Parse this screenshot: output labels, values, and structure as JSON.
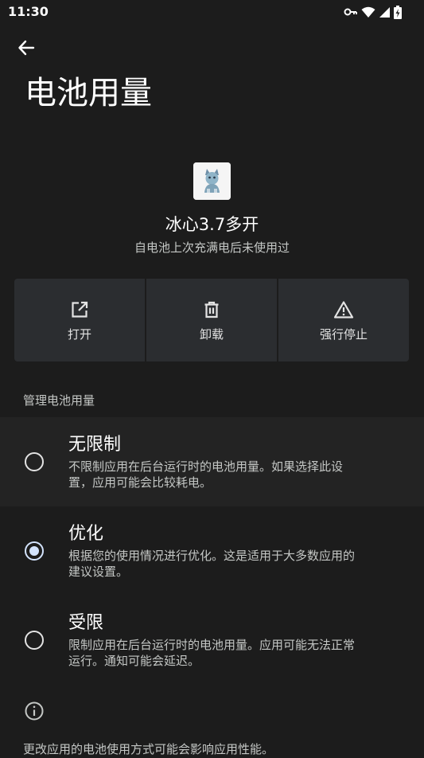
{
  "status_bar": {
    "time": "11:30",
    "icons": [
      "vpn-key-icon",
      "wifi-icon",
      "signal-icon",
      "battery-charging-icon"
    ]
  },
  "header": {
    "back_icon": "arrow-back-icon",
    "title": "电池用量"
  },
  "app": {
    "icon": "app-avatar-icon",
    "name": "冰心3.7多开",
    "summary": "自电池上次充满电后未使用过"
  },
  "actions": [
    {
      "icon": "open-external-icon",
      "label": "打开"
    },
    {
      "icon": "trash-icon",
      "label": "卸载"
    },
    {
      "icon": "warning-icon",
      "label": "强行停止"
    }
  ],
  "manage_section": {
    "header": "管理电池用量",
    "options": [
      {
        "title": "无限制",
        "description": "不限制应用在后台运行时的电池用量。如果选择此设置，应用可能会比较耗电。",
        "desc_line1": "不限制应用在后台运行时的电池用量。如果选择此设",
        "desc_line2": "置，应用可能会比较耗电。",
        "selected": false
      },
      {
        "title": "优化",
        "description": "根据您的使用情况进行优化。这是适用于大多数应用的建议设置。",
        "desc_line1": "根据您的使用情况进行优化。这是适用于大多数应用的",
        "desc_line2": "建议设置。",
        "selected": true
      },
      {
        "title": "受限",
        "description": "限制应用在后台运行时的电池用量。应用可能无法正常运行。通知可能会延迟。",
        "desc_line1": "限制应用在后台运行时的电池用量。应用可能无法正常",
        "desc_line2": "运行。通知可能会延迟。",
        "selected": false
      }
    ]
  },
  "footer": {
    "icon": "info-icon",
    "text": "更改应用的电池使用方式可能会影响应用性能。"
  },
  "colors": {
    "background": "#1c1c1c",
    "surface": "#2b2d30",
    "accent": "#d3e3fd",
    "text_primary": "#ffffff",
    "text_secondary": "#c4c7c5"
  }
}
